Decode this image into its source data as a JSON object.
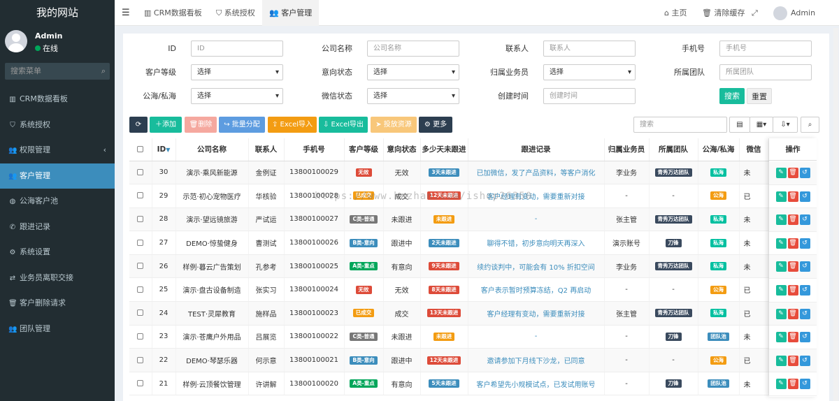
{
  "brand": "我的网站",
  "user": {
    "name": "Admin",
    "status": "在线"
  },
  "sidebar_search": {
    "placeholder": "搜索菜单"
  },
  "menu": [
    {
      "label": "CRM数据看板",
      "icon": "bar-chart-icon"
    },
    {
      "label": "系统授权",
      "icon": "shield-icon"
    },
    {
      "label": "权限管理",
      "icon": "group-icon"
    },
    {
      "label": "客户管理",
      "icon": "users-icon"
    },
    {
      "label": "公海客户池",
      "icon": "globe-icon"
    },
    {
      "label": "跟进记录",
      "icon": "phone-icon"
    },
    {
      "label": "系统设置",
      "icon": "cogs-icon"
    },
    {
      "label": "业务员离职交接",
      "icon": "exchange-icon"
    },
    {
      "label": "客户删除请求",
      "icon": "trash-icon"
    },
    {
      "label": "团队管理",
      "icon": "users-icon"
    }
  ],
  "tabs": [
    {
      "label": "CRM数据看板",
      "icon": "bar-chart-icon"
    },
    {
      "label": "系统授权",
      "icon": "shield-icon"
    },
    {
      "label": "客户管理",
      "icon": "users-icon"
    }
  ],
  "topbar_right": {
    "home": "主页",
    "clear_cache": "清除缓存",
    "admin": "Admin"
  },
  "filters": {
    "id_label": "ID",
    "id_placeholder": "ID",
    "company_label": "公司名称",
    "company_placeholder": "公司名称",
    "contact_label": "联系人",
    "contact_placeholder": "联系人",
    "phone_label": "手机号",
    "phone_placeholder": "手机号",
    "level_label": "客户等级",
    "level_value": "选择",
    "intent_label": "意向状态",
    "intent_value": "选择",
    "owner_label": "归属业务员",
    "owner_value": "选择",
    "team_label": "所属团队",
    "team_placeholder": "所属团队",
    "pool_label": "公海/私海",
    "pool_value": "选择",
    "wechat_label": "微信状态",
    "wechat_value": "选择",
    "created_label": "创建时间",
    "created_placeholder": "创建时间",
    "search_button": "搜索",
    "reset_button": "重置"
  },
  "toolbar": {
    "add": "添加",
    "delete": "删除",
    "assign": "批量分配",
    "import": "Excel导入",
    "export": "Excel导出",
    "release": "投放资源",
    "more": "更多",
    "search_placeholder": "搜索"
  },
  "table": {
    "headers": [
      "ID",
      "公司名称",
      "联系人",
      "手机号",
      "客户等级",
      "意向状态",
      "多少天未跟进",
      "跟进记录",
      "归属业务员",
      "所属团队",
      "公海/私海",
      "微信",
      "操作"
    ],
    "rows": [
      {
        "id": "30",
        "company": "演示·乘风新能源",
        "contact": "金例证",
        "phone": "13800100029",
        "level": "无效",
        "level_color": "#dd4b39",
        "intent": "无效",
        "days": "3天未跟进",
        "days_color": "#3c8dbc",
        "note": "已加微信，发了产品资料，等客户消化",
        "owner": "李业务",
        "team": "青秀万达团队",
        "team_color": "#3a4a5e",
        "pool": "私海",
        "pool_color": "#00c0a0",
        "wechat": "未"
      },
      {
        "id": "29",
        "company": "示范·初心宠物医疗",
        "contact": "华核验",
        "phone": "13800100028",
        "level": "已成交",
        "level_color": "#f39c12",
        "intent": "成交",
        "days": "12天未跟进",
        "days_color": "#dd4b39",
        "note": "客户经理有变动，需要重新对接",
        "owner": "-",
        "team": "-",
        "team_color": "",
        "pool": "公海",
        "pool_color": "#f39c12",
        "wechat": "已"
      },
      {
        "id": "28",
        "company": "演示·望远镜旅游",
        "contact": "严试运",
        "phone": "13800100027",
        "level": "C类-普通",
        "level_color": "#777",
        "intent": "未跟进",
        "days": "未跟进",
        "days_color": "#f39c12",
        "note": "-",
        "owner": "张主管",
        "team": "青秀万达团队",
        "team_color": "#3a4a5e",
        "pool": "私海",
        "pool_color": "#00c0a0",
        "wechat": "未"
      },
      {
        "id": "27",
        "company": "DEMO·惊蛰健身",
        "contact": "曹测试",
        "phone": "13800100026",
        "level": "B类-意向",
        "level_color": "#3c8dbc",
        "intent": "跟进中",
        "days": "2天未跟进",
        "days_color": "#3c8dbc",
        "note": "聊得不错，初步意向明天再深入",
        "owner": "演示账号",
        "team": "刀锋",
        "team_color": "#3a4a5e",
        "pool": "私海",
        "pool_color": "#00c0a0",
        "wechat": "未"
      },
      {
        "id": "26",
        "company": "样例·暮云广告策划",
        "contact": "孔参考",
        "phone": "13800100025",
        "level": "A类-重点",
        "level_color": "#00a65a",
        "intent": "有意向",
        "days": "9天未跟进",
        "days_color": "#dd4b39",
        "note": "续约谈判中，可能会有 10% 折扣空间",
        "owner": "李业务",
        "team": "青秀万达团队",
        "team_color": "#3a4a5e",
        "pool": "私海",
        "pool_color": "#00c0a0",
        "wechat": "未"
      },
      {
        "id": "25",
        "company": "演示·盘古设备制造",
        "contact": "张实习",
        "phone": "13800100024",
        "level": "无效",
        "level_color": "#dd4b39",
        "intent": "无效",
        "days": "8天未跟进",
        "days_color": "#dd4b39",
        "note": "客户表示暂时预算冻结，Q2 再启动",
        "owner": "-",
        "team": "-",
        "team_color": "",
        "pool": "公海",
        "pool_color": "#f39c12",
        "wechat": "已"
      },
      {
        "id": "24",
        "company": "TEST·灵犀教育",
        "contact": "施样品",
        "phone": "13800100023",
        "level": "已成交",
        "level_color": "#f39c12",
        "intent": "成交",
        "days": "13天未跟进",
        "days_color": "#dd4b39",
        "note": "客户经理有变动，需要重新对接",
        "owner": "张主管",
        "team": "青秀万达团队",
        "team_color": "#3a4a5e",
        "pool": "私海",
        "pool_color": "#00c0a0",
        "wechat": "已"
      },
      {
        "id": "23",
        "company": "演示·苍鹰户外用品",
        "contact": "吕展览",
        "phone": "13800100022",
        "level": "C类-普通",
        "level_color": "#777",
        "intent": "未跟进",
        "days": "未跟进",
        "days_color": "#f39c12",
        "note": "-",
        "owner": "-",
        "team": "刀锋",
        "team_color": "#3a4a5e",
        "pool": "团队池",
        "pool_color": "#3c8dbc",
        "wechat": "未"
      },
      {
        "id": "22",
        "company": "DEMO·琴瑟乐器",
        "contact": "何示意",
        "phone": "13800100021",
        "level": "B类-意向",
        "level_color": "#3c8dbc",
        "intent": "跟进中",
        "days": "12天未跟进",
        "days_color": "#dd4b39",
        "note": "邀请参加下月线下沙龙，已同意",
        "owner": "-",
        "team": "-",
        "team_color": "",
        "pool": "公海",
        "pool_color": "#f39c12",
        "wechat": "已"
      },
      {
        "id": "21",
        "company": "样例·云顶餐饮管理",
        "contact": "许讲解",
        "phone": "13800100020",
        "level": "A类-重点",
        "level_color": "#00a65a",
        "intent": "有意向",
        "days": "5天未跟进",
        "days_color": "#3c8dbc",
        "note": "客户希望先小规模试点，已发试用账号",
        "owner": "-",
        "team": "刀锋",
        "team_color": "#3a4a5e",
        "pool": "团队池",
        "pool_color": "#3c8dbc",
        "wechat": "未"
      }
    ]
  },
  "watermark": "https://www.huzhan.com/ishop26350",
  "colors": {
    "sidebar": "#222d32",
    "active": "#3c8dbc",
    "success": "#18bc9c",
    "danger": "#e74c3c"
  }
}
